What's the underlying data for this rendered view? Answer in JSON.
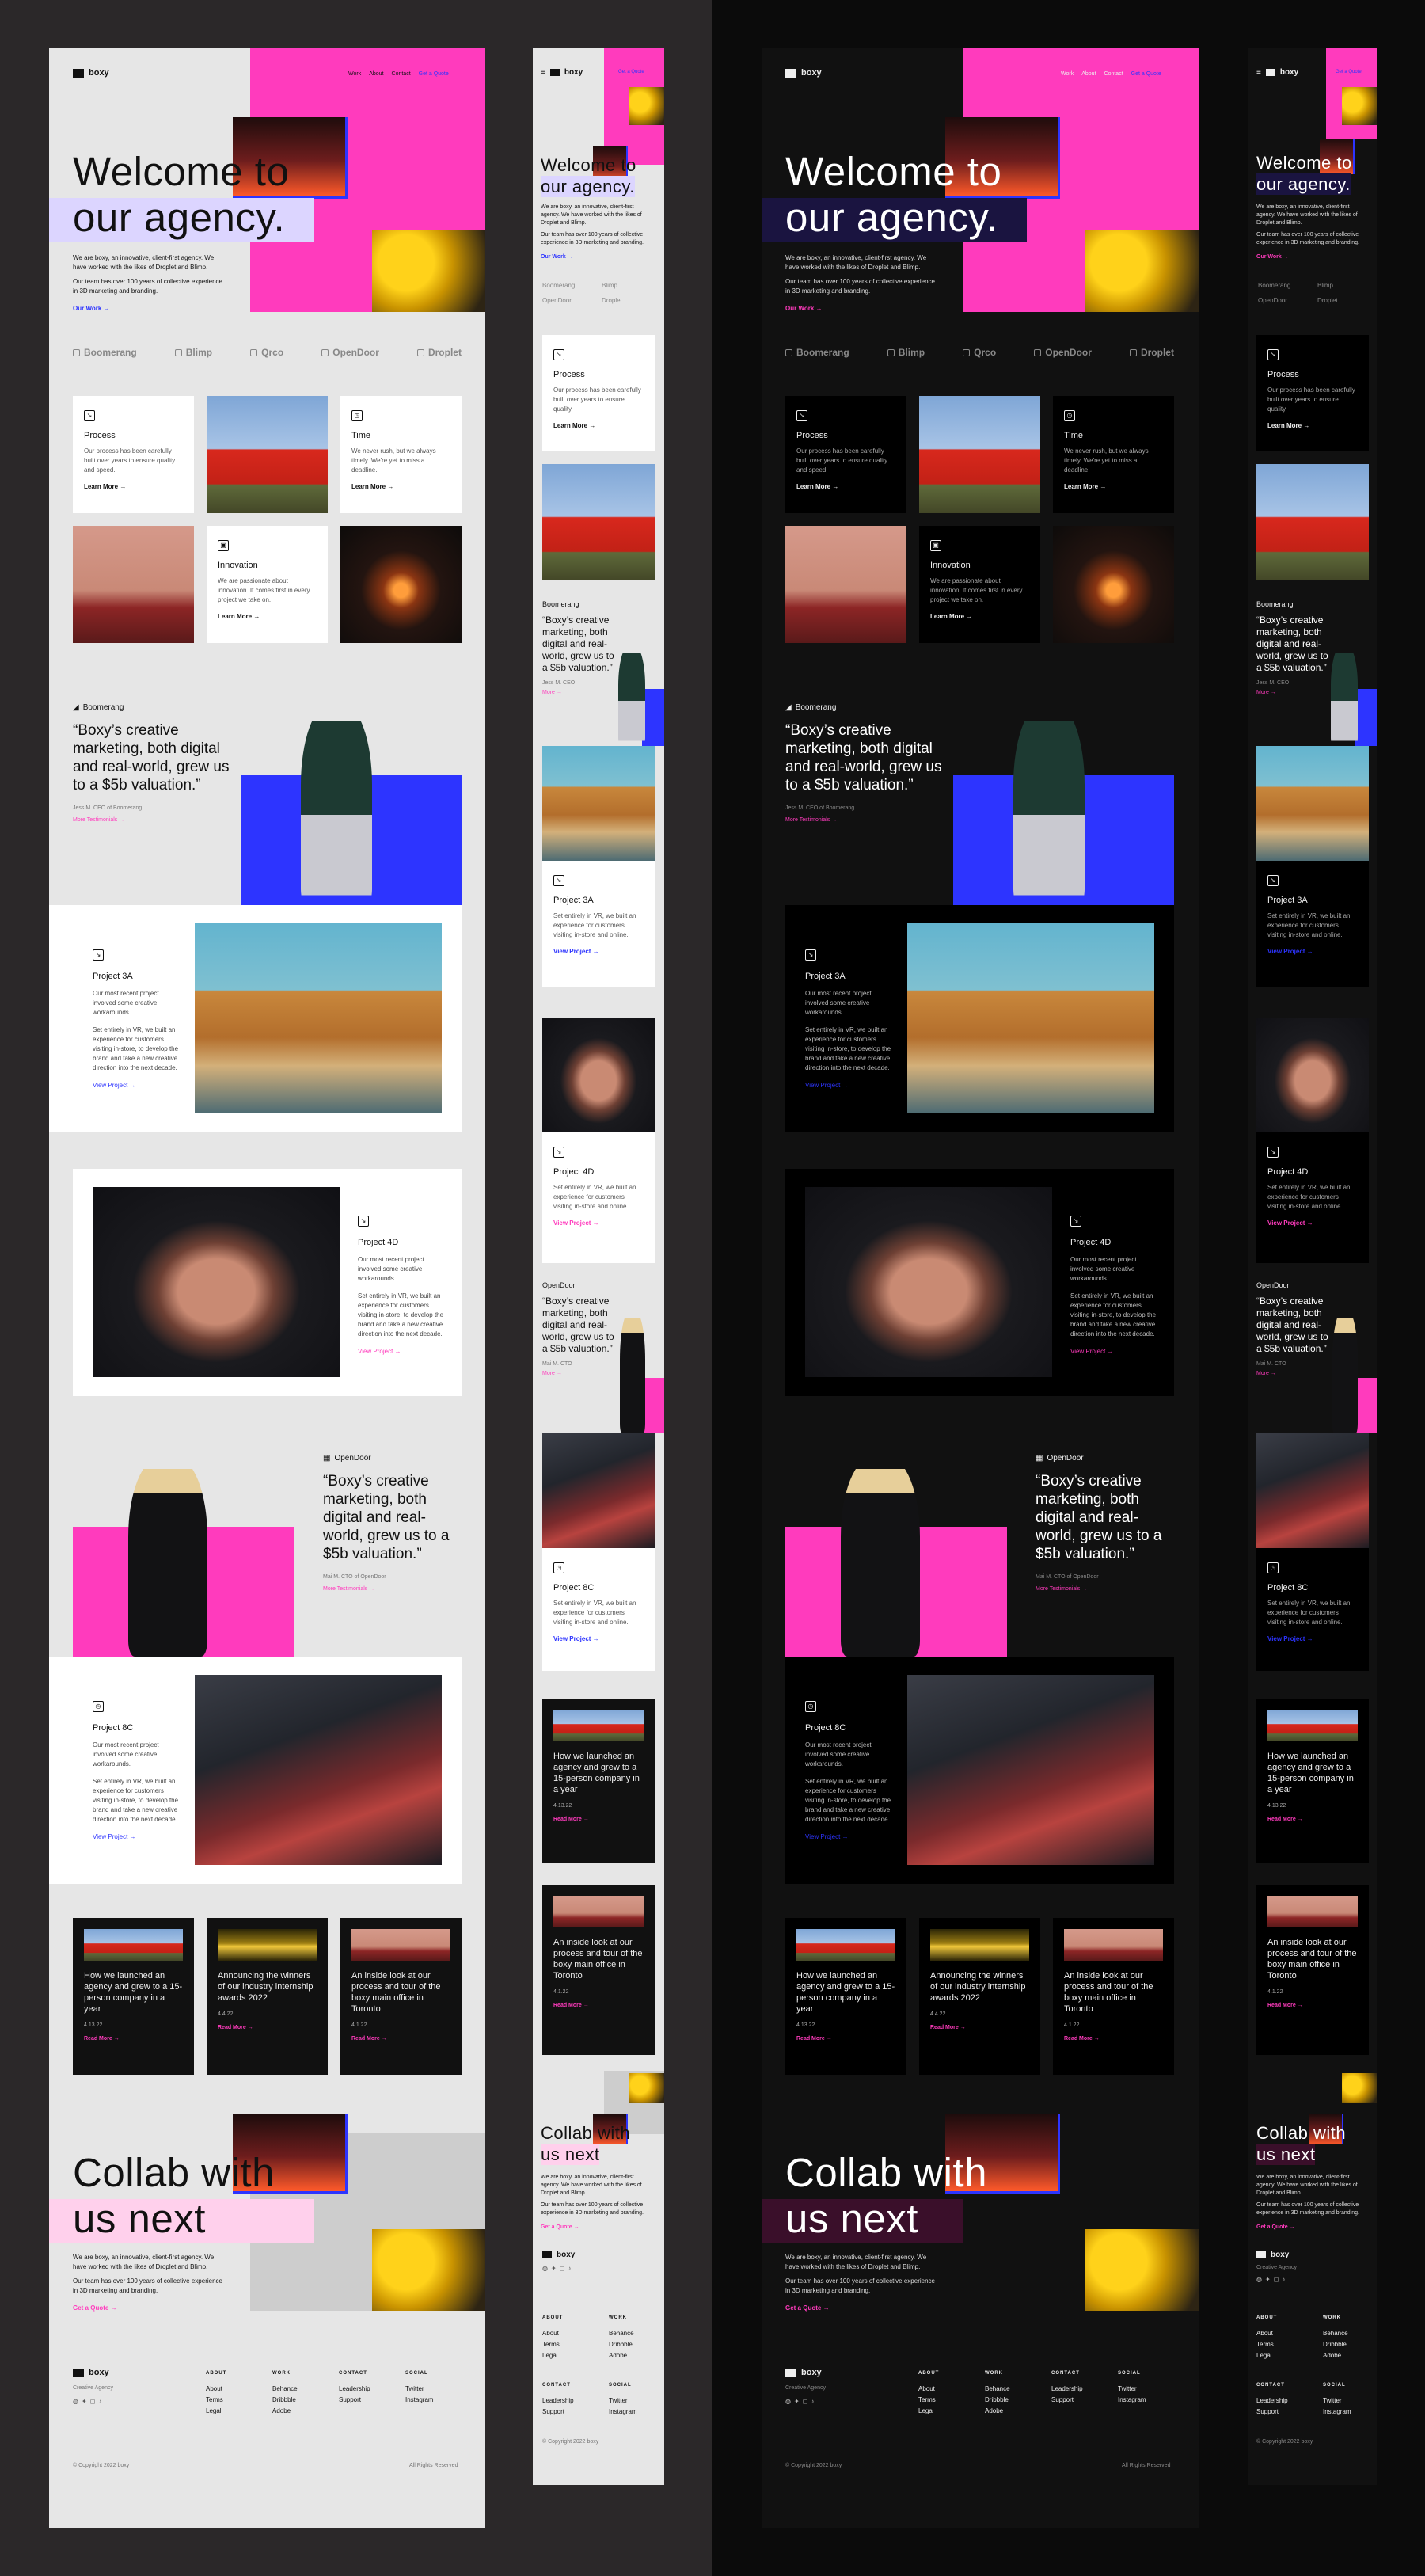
{
  "brand": {
    "name": "boxy",
    "tagline": "Creative Agency"
  },
  "colors": {
    "pink": "#ff3bbd",
    "blue": "#2d34ff",
    "light_bg": "#e6e6e6",
    "dark_bg": "#111111"
  },
  "nav": {
    "work": "Work",
    "about": "About",
    "contact": "Contact",
    "quote": "Get a Quote",
    "menu_icon": "hamburger-icon"
  },
  "hero": {
    "line1": "Welcome to",
    "line2": "our agency.",
    "p1": "We are boxy, an innovative, client-first agency. We have worked with the likes of Droplet and Blimp.",
    "p2": "Our team has over 100 years of collective experience in 3D marketing and branding.",
    "link": "Our Work →"
  },
  "clients": [
    "Boomerang",
    "Blimp",
    "Qrco",
    "OpenDoor",
    "Droplet"
  ],
  "services": [
    {
      "title": "Process",
      "text": "Our process has been carefully built over years to ensure quality and speed.",
      "link": "Learn More →"
    },
    {
      "title": "Time",
      "text": "We never rush, but we always timely. We're yet to miss a deadline.",
      "link": "Learn More →"
    },
    {
      "title": "Innovation",
      "text": "We are passionate about innovation. It comes first in every project we take on.",
      "link": "Learn More →"
    }
  ],
  "services_mobile": {
    "text": "Our process has been carefully built over years to ensure quality."
  },
  "testimonials": [
    {
      "brand": "Boomerang",
      "quote": "“Boxy’s creative marketing, both digital and real-world, grew us to a $5b valuation.”",
      "author": "Jess M. CEO of Boomerang",
      "author_short": "Jess M. CEO",
      "link": "More Testimonials →",
      "link_short": "More →"
    },
    {
      "brand": "OpenDoor",
      "quote": "“Boxy’s creative marketing, both digital and real-world, grew us to a $5b valuation.”",
      "author": "Mai M. CTO of OpenDoor",
      "author_short": "Mai M. CTO",
      "link": "More Testimonials →",
      "link_short": "More →"
    }
  ],
  "projects": [
    {
      "title": "Project 3A",
      "p1": "Our most recent project involved some creative workarounds.",
      "p2": "Set entirely in VR, we built an experience for customers visiting in-store, to develop the brand and take a new creative direction into the next decade.",
      "p2_short": "Set entirely in VR, we built an experience for customers visiting in-store and online.",
      "link": "View Project →"
    },
    {
      "title": "Project 4D",
      "p1": "Our most recent project involved some creative workarounds.",
      "p2": "Set entirely in VR, we built an experience for customers visiting in-store, to develop the brand and take a new creative direction into the next decade.",
      "p2_short": "Set entirely in VR, we built an experience for customers visiting in-store and online.",
      "link": "View Project →"
    },
    {
      "title": "Project 8C",
      "p1": "Our most recent project involved some creative workarounds.",
      "p2": "Set entirely in VR, we built an experience for customers visiting in-store, to develop the brand and take a new creative direction into the next decade.",
      "p2_short": "Set entirely in VR, we built an experience for customers visiting in-store and online.",
      "link": "View Project →"
    }
  ],
  "news": [
    {
      "title": "How we launched an agency and grew to a 15-person company in a year",
      "date": "4.13.22",
      "link": "Read More →"
    },
    {
      "title": "Announcing the winners of our industry internship awards 2022",
      "date": "4.4.22",
      "link": "Read More →"
    },
    {
      "title": "An inside look at our process and tour of the boxy main office in Toronto",
      "date": "4.1.22",
      "link": "Read More →"
    }
  ],
  "collab": {
    "line1": "Collab with",
    "line2": "us next",
    "p1": "We are boxy, an innovative, client-first agency. We have worked with the likes of Droplet and Blimp.",
    "p2": "Our team has over 100 years of collective experience in 3D marketing and branding.",
    "link": "Get a Quote →"
  },
  "footer": {
    "about_h": "ABOUT",
    "about": [
      "About",
      "Terms",
      "Legal"
    ],
    "work_h": "WORK",
    "work": [
      "Behance",
      "Dribbble",
      "Adobe"
    ],
    "contact_h": "CONTACT",
    "contact": [
      "Leadership",
      "Support"
    ],
    "social_h": "SOCIAL",
    "social": [
      "Twitter",
      "Instagram"
    ],
    "social_icons": [
      "dribbble-icon",
      "twitter-icon",
      "instagram-icon",
      "tiktok-icon"
    ],
    "copyright": "© Copyright 2022 boxy",
    "rights": "All Rights Reserved"
  }
}
